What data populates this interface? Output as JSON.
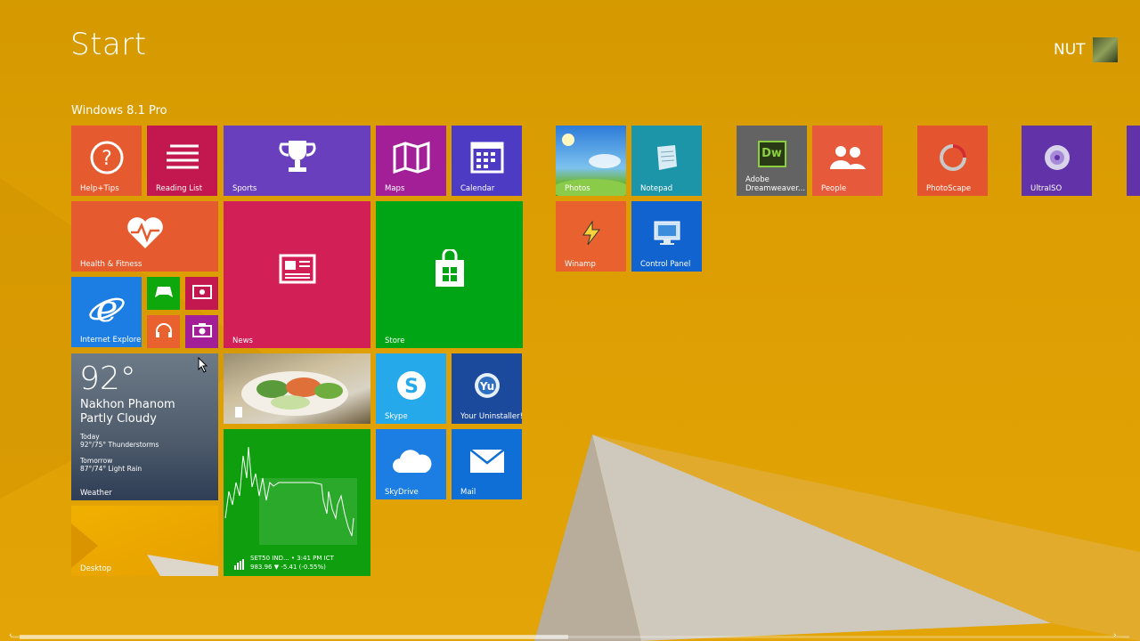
{
  "screen": {
    "title": "Start",
    "group_label": "Windows 8.1 Pro"
  },
  "user": {
    "name": "NUT"
  },
  "tiles": {
    "help": "Help+Tips",
    "reading": "Reading List",
    "sports": "Sports",
    "maps": "Maps",
    "calendar": "Calendar",
    "health": "Health & Fitness",
    "news": "News",
    "store": "Store",
    "ie": "Internet Explorer",
    "skype": "Skype",
    "uninstaller": "Your Uninstaller!",
    "weather": "Weather",
    "skydrive": "SkyDrive",
    "mail": "Mail",
    "desktop": "Desktop",
    "photos": "Photos",
    "notepad": "Notepad",
    "winamp": "Winamp",
    "control_panel": "Control Panel",
    "dreamweaver": "Adobe Dreamweaver...",
    "people": "People",
    "photoscape": "PhotoScape",
    "ultraiso": "UltraISO"
  },
  "weather": {
    "temp": "92°",
    "city": "Nakhon Phanom",
    "condition": "Partly Cloudy",
    "today_label": "Today",
    "today_forecast": "92°/75° Thunderstorms",
    "tomorrow_label": "Tomorrow",
    "tomorrow_forecast": "87°/74° Light Rain"
  },
  "finance": {
    "line1": "SET50 IND... • 3:41 PM ICT",
    "line2": "983.96 ▼ -5.41 (-0.55%)"
  },
  "icons": {
    "dreamweaver_glyph": "Dw",
    "help": "help-icon",
    "reading": "reading-list-icon",
    "sports": "trophy-icon",
    "maps": "map-icon",
    "calendar": "calendar-icon",
    "health": "heart-icon",
    "news": "news-icon",
    "store": "store-icon",
    "ie": "ie-icon"
  },
  "colors": {
    "background": "#dd9e03",
    "accent": "#00a515"
  }
}
